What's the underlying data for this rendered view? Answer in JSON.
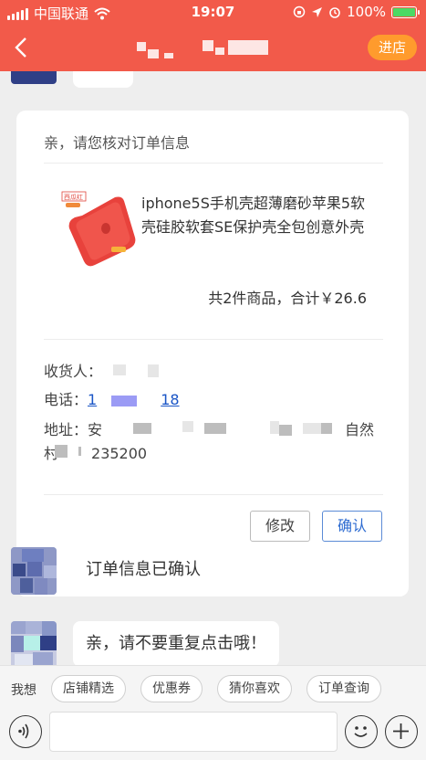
{
  "status_bar": {
    "carrier": "中国联通",
    "time": "19:07",
    "battery": "100%"
  },
  "nav": {
    "enter_shop": "进店"
  },
  "order_card": {
    "title": "亲，请您核对订单信息",
    "product_name": "iphone5S手机壳超薄磨砂苹果5软壳硅胶软套SE保护壳全包创意外壳",
    "product_badge": "西瓜红",
    "total": "共2件商品，合计￥26.6",
    "recipient_label": "收货人：",
    "phone_label": "电话：",
    "phone_visible_start": "1",
    "phone_visible_end": "18",
    "address_label": "地址：",
    "address_start": "安",
    "address_end": "自然",
    "address_line2_start": "村",
    "postal_code": "235200",
    "modify_button": "修改",
    "confirm_button": "确认"
  },
  "messages": [
    {
      "text": "订单信息已确认"
    },
    {
      "text": "亲，请不要重复点击哦！"
    }
  ],
  "quick_bar": {
    "label": "我想",
    "chips": [
      "店铺精选",
      "优惠券",
      "猜你喜欢",
      "订单查询"
    ]
  },
  "colors": {
    "brand": "#f25a4a",
    "enter_shop": "#ff9b2d",
    "battery": "#4cd964",
    "confirm": "#2d6bd1"
  }
}
